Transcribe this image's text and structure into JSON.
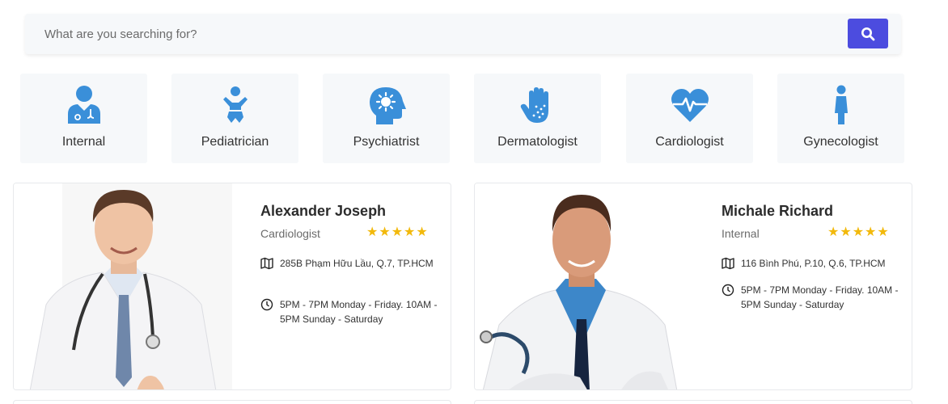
{
  "search": {
    "placeholder": "What are you searching for?"
  },
  "categories": [
    {
      "label": "Internal",
      "icon": "doctor-icon"
    },
    {
      "label": "Pediatrician",
      "icon": "baby-icon"
    },
    {
      "label": "Psychiatrist",
      "icon": "head-brain-icon"
    },
    {
      "label": "Dermatologist",
      "icon": "hand-skin-icon"
    },
    {
      "label": "Cardiologist",
      "icon": "heart-pulse-icon"
    },
    {
      "label": "Gynecologist",
      "icon": "female-icon"
    }
  ],
  "doctors": [
    {
      "name": "Alexander Joseph",
      "specialty": "Cardiologist",
      "rating": 5,
      "stars": "★★★★★",
      "address": "285B Phạm Hữu Lầu, Q.7, TP.HCM",
      "hours": "5PM - 7PM Monday - Friday. 10AM - 5PM Sunday - Saturday"
    },
    {
      "name": "Michale Richard",
      "specialty": "Internal",
      "rating": 5,
      "stars": "★★★★★",
      "address": "116 Bình Phú, P.10, Q.6, TP.HCM",
      "hours": "5PM - 7PM Monday - Friday. 10AM - 5PM Sunday - Saturday"
    }
  ],
  "colors": {
    "accent": "#4c4cdf",
    "icon": "#3a8fd9",
    "star": "#f2b90c",
    "tile": "#f6f8fa"
  }
}
